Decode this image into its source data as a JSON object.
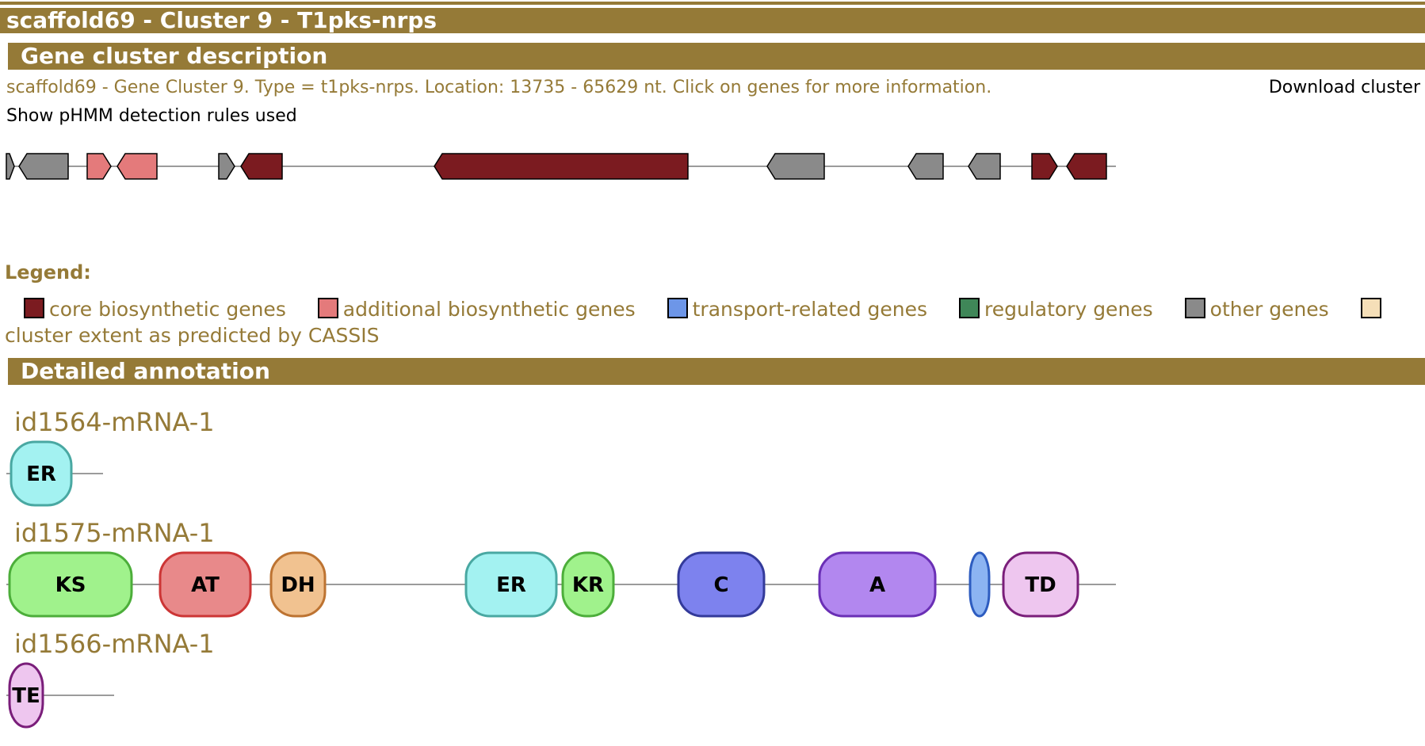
{
  "title": "scaffold69 - Cluster 9 - T1pks-nrps",
  "sections": {
    "description": "Gene cluster description",
    "detailed": "Detailed annotation"
  },
  "description_text": "scaffold69 - Gene Cluster 9. Type = t1pks-nrps. Location: 13735 - 65629 nt. Click on genes for more information.",
  "download_link": "Download cluster",
  "phmm_link": "Show pHMM detection rules used",
  "legend": {
    "title": "Legend:",
    "items": [
      {
        "label": "core biosynthetic genes",
        "color": "#7b1b20"
      },
      {
        "label": "additional biosynthetic genes",
        "color": "#e47a7b"
      },
      {
        "label": "transport-related genes",
        "color": "#6d96e8"
      },
      {
        "label": "regulatory genes",
        "color": "#3f8758"
      },
      {
        "label": "other genes",
        "color": "#8a8a8a"
      },
      {
        "label": "cluster extent as predicted by CASSIS",
        "color": "#f5dfb8"
      }
    ]
  },
  "cluster_genes": [
    {
      "type": "other",
      "strand": "+"
    },
    {
      "type": "other",
      "strand": "-"
    },
    {
      "type": "additional",
      "strand": "+"
    },
    {
      "type": "additional",
      "strand": "-"
    },
    {
      "type": "other",
      "strand": "+"
    },
    {
      "type": "core",
      "strand": "-"
    },
    {
      "type": "core",
      "strand": "-"
    },
    {
      "type": "other",
      "strand": "-"
    },
    {
      "type": "other",
      "strand": "-"
    },
    {
      "type": "other",
      "strand": "-"
    },
    {
      "type": "core",
      "strand": "+"
    },
    {
      "type": "core",
      "strand": "-"
    }
  ],
  "genes": [
    {
      "name": "id1564-mRNA-1",
      "domains": [
        {
          "label": "ER",
          "fill": "#a3f2f1",
          "stroke": "#49a8a2"
        }
      ]
    },
    {
      "name": "id1575-mRNA-1",
      "domains": [
        {
          "label": "KS",
          "fill": "#a0f28c",
          "stroke": "#4cae3a"
        },
        {
          "label": "AT",
          "fill": "#e8898a",
          "stroke": "#cc3535"
        },
        {
          "label": "DH",
          "fill": "#f1c290",
          "stroke": "#bd7331"
        },
        {
          "label": "ER",
          "fill": "#a3f2f1",
          "stroke": "#49a8a2"
        },
        {
          "label": "KR",
          "fill": "#a0f28c",
          "stroke": "#4cae3a"
        },
        {
          "label": "C",
          "fill": "#7d82ee",
          "stroke": "#333a9a"
        },
        {
          "label": "A",
          "fill": "#b287ef",
          "stroke": "#6a2fb5"
        },
        {
          "label": "",
          "fill": "#8cb4f2",
          "stroke": "#2d5cc0"
        },
        {
          "label": "TD",
          "fill": "#eec6ef",
          "stroke": "#7a1e7a"
        }
      ]
    },
    {
      "name": "id1566-mRNA-1",
      "domains": [
        {
          "label": "TE",
          "fill": "#eec6ef",
          "stroke": "#7a1e7a"
        }
      ]
    }
  ]
}
